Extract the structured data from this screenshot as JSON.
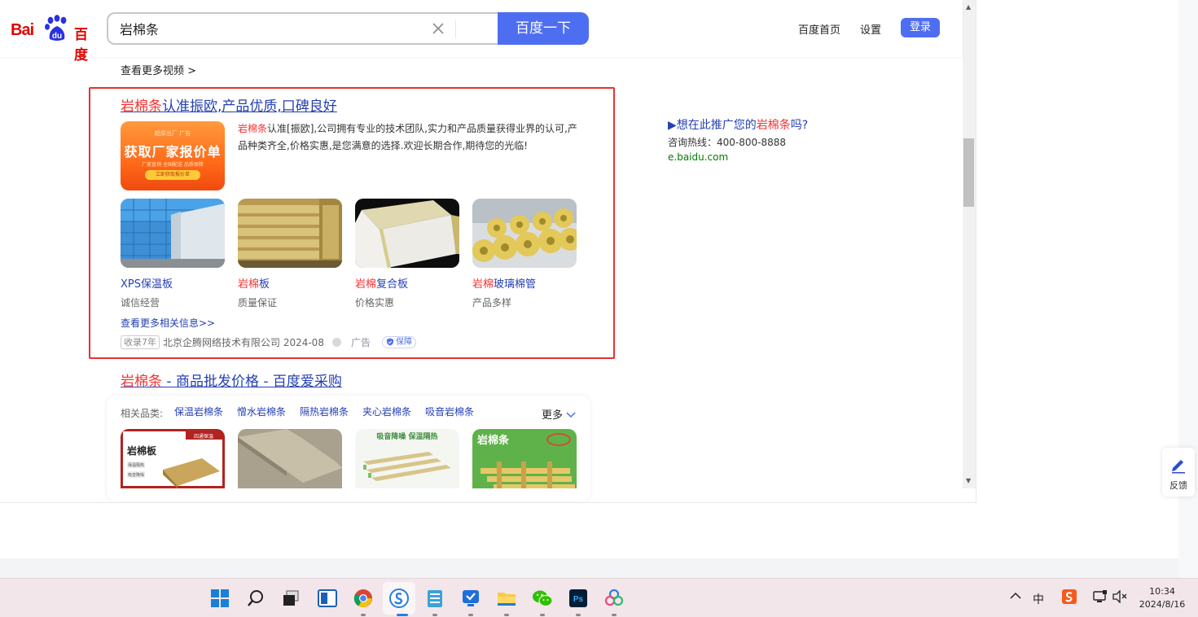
{
  "header": {
    "logo_text_latin": "Bai",
    "logo_du": "du",
    "logo_text_cn": "百度",
    "search_value": "岩棉条",
    "search_button": "百度一下",
    "nav_home": "百度首页",
    "nav_settings": "设置",
    "login": "登录"
  },
  "main": {
    "more_videos": "查看更多视频 >",
    "ad": {
      "title_highlight": "岩棉条",
      "title_rest": "认准振欧,产品优质,口碑良好",
      "thumb_top": "超厚出厂 广告",
      "thumb_main": "获取厂家报价单",
      "thumb_sub": "厂家直销 全国配送 品质保障",
      "thumb_btn": "立即获取报价单",
      "desc_highlight": "岩棉条",
      "desc_rest": "认准[振欧],公司拥有专业的技术团队,实力和产品质量获得业界的认可,产品种类齐全,价格实惠,是您满意的选择.欢迎长期合作,期待您的光临!",
      "products": [
        {
          "name_hl": "",
          "name": "XPS保温板",
          "sub": "诚信经营"
        },
        {
          "name_hl": "岩棉",
          "name": "板",
          "sub": "质量保证"
        },
        {
          "name_hl": "岩棉",
          "name": "复合板",
          "sub": "价格实惠"
        },
        {
          "name_hl": "岩棉",
          "name": "玻璃棉管",
          "sub": "产品多样"
        }
      ],
      "more_info": "查看更多相关信息>>",
      "record_tag": "收录7年",
      "company": "北京企腾网络技术有限公司 2024-08",
      "ad_label": "广告",
      "guarantee": "保障"
    },
    "result2": {
      "title_highlight": "岩棉条",
      "title_rest": " - 商品批发价格 - 百度爱采购",
      "category_label": "相关品类:",
      "categories": [
        "保温岩棉条",
        "憎水岩棉条",
        "隔热岩棉条",
        "夹心岩棉条",
        "吸音岩棉条"
      ],
      "more": "更多",
      "img1_tag": "四通保温",
      "img1_title": "岩棉板",
      "img1_chip1": "保温隔热",
      "img1_chip2": "吸音降噪",
      "img3_text": "吸音降噪 保温隔热",
      "img4_title": "岩棉条"
    }
  },
  "sidebar": {
    "promo_prefix": "▶想在此推广您的",
    "promo_highlight": "岩棉条",
    "promo_suffix": "吗?",
    "phone": "咨询热线：400-800-8888",
    "url": "e.baidu.com"
  },
  "feedback": "反馈",
  "taskbar": {
    "ime": "中",
    "time": "10:34",
    "date": "2024/8/16"
  },
  "colors": {
    "baidu_blue": "#4e6ef2",
    "link_blue": "#2440b3",
    "highlight_red": "#f73131",
    "ad_border": "#e8312f",
    "url_green": "#008000"
  }
}
